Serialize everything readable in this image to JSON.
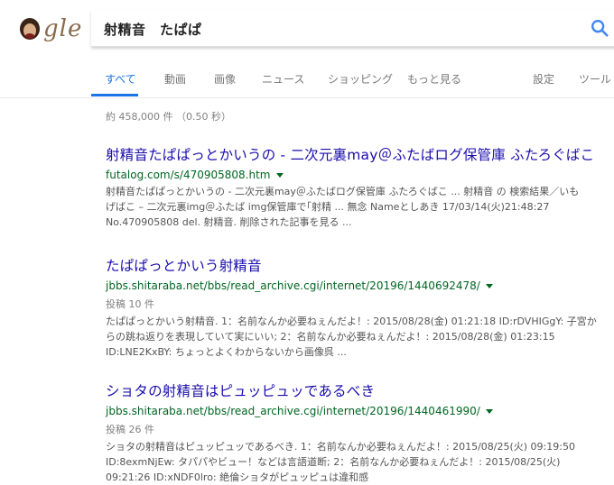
{
  "logo": {
    "text": "gle"
  },
  "search": {
    "query": "射精音　たぱぱ"
  },
  "nav": {
    "tabs": [
      "すべて",
      "動画",
      "画像",
      "ニュース",
      "ショッピング",
      "もっと見る"
    ],
    "settings": "設定",
    "tools": "ツール"
  },
  "stats": "約 458,000 件 （0.50 秒）",
  "results": [
    {
      "title": "射精音たぱぱっとかいうの - 二次元裏may＠ふたばログ保管庫 ふたろぐばこ",
      "url": "futalog.com/s/470905808.htm",
      "meta": "",
      "snippet": [
        "射精音たぱぱっとかいうの - 二次元裏may＠ふたばログ保管庫 ふたろぐばこ ... 射精音 の 検索結果／いも",
        "げばこ – 二次元裏img＠ふたば img保管庫で｢射精 ... 無念 Nameとしあき 17/03/14(火)21:48:27",
        "No.470905808 del. 射精音. 削除された記事を見る ..."
      ]
    },
    {
      "title": "たぱぱっとかいう射精音",
      "url": "jbbs.shitaraba.net/bbs/read_archive.cgi/internet/20196/1440692478/",
      "meta": "投稿 10 件",
      "snippet": [
        "たぱぱっとかいう射精音. 1：名前なんか必要ねぇんだよ！: 2015/08/28(金) 01:21:18 ID:rDVHIGgY: 子宮か",
        "らの跳ね返りを表現していて実にいい; 2：名前なんか必要ねぇんだよ！: 2015/08/28(金) 01:23:15",
        "ID:LNE2KxBY: ちょっとよくわからないから画像呉 ..."
      ]
    },
    {
      "title": "ショタの射精音はピュッピュッであるべき",
      "url": "jbbs.shitaraba.net/bbs/read_archive.cgi/internet/20196/1440461990/",
      "meta": "投稿 26 件",
      "snippet": [
        "ショタの射精音はピュッピュッであるべき. 1：名前なんか必要ねぇんだよ！: 2015/08/25(火) 09:19:50",
        "ID:8exmNjEw: タパパやビュー！などは言語道断; 2：名前なんか必要ねぇんだよ！: 2015/08/25(火)",
        "09:21:26 ID:xNDF0lro: 絶倫ショタがピュッピュは違和感"
      ]
    }
  ],
  "colors": {
    "link": "#1a0dab",
    "url": "#006621",
    "accent": "#1a73e8"
  }
}
